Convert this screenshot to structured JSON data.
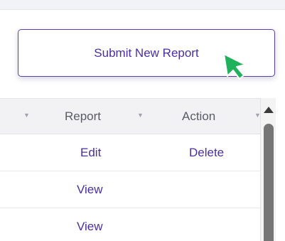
{
  "toolbar": {
    "submit_label": "Submit New Report"
  },
  "table": {
    "columns": [
      {
        "label": "Report"
      },
      {
        "label": "Action"
      }
    ],
    "rows": [
      {
        "report": "Edit",
        "action": "Delete"
      },
      {
        "report": "View",
        "action": ""
      },
      {
        "report": "View",
        "action": ""
      }
    ]
  },
  "icons": {
    "sort": "filter-icon",
    "cursor": "mouse-pointer-icon",
    "scroll_up": "scroll-up-arrow-icon"
  },
  "colors": {
    "accent": "#4a2fa3",
    "border": "#5b3fb0",
    "cursor": "#1fb25a"
  }
}
